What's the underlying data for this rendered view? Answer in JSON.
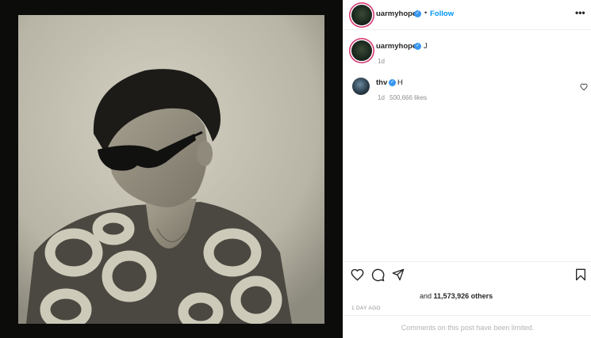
{
  "post": {
    "author": "uarmyhope",
    "follow_label": "Follow",
    "caption": "J",
    "caption_time": "1d",
    "likes_prefix": "and",
    "likes_count": "11,573,926 others",
    "time_ago": "1 DAY AGO",
    "comments_limited": "Comments on this post have been limited."
  },
  "comment": {
    "author": "thv",
    "text": "H",
    "time": "1d",
    "likes": "500,666 likes"
  },
  "colors": {
    "accent": "#0095f6",
    "verified": "#3897f0",
    "story_ring": "#d42f6c"
  },
  "icons": {
    "more": "more-horizontal-icon",
    "like": "heart-icon",
    "comment": "comment-bubble-icon",
    "share": "paper-plane-icon",
    "save": "bookmark-icon",
    "verified": "verified-badge-icon",
    "comment_like": "heart-icon"
  }
}
